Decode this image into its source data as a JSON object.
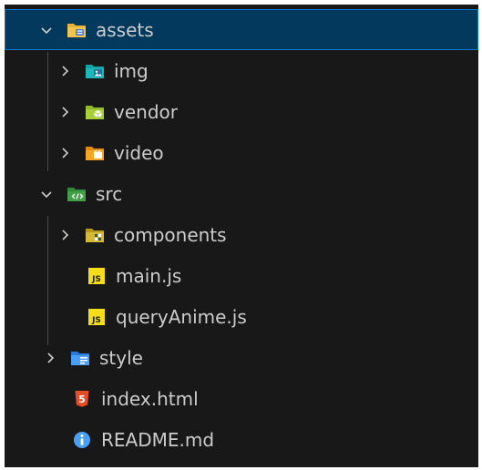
{
  "explorer": {
    "items": [
      {
        "label": "assets",
        "type": "folder",
        "state": "expanded",
        "depth": 0,
        "icon": "folder-assets-icon",
        "selected": true
      },
      {
        "label": "img",
        "type": "folder",
        "state": "collapsed",
        "depth": 1,
        "icon": "folder-images-icon"
      },
      {
        "label": "vendor",
        "type": "folder",
        "state": "collapsed",
        "depth": 1,
        "icon": "folder-vendor-icon"
      },
      {
        "label": "video",
        "type": "folder",
        "state": "collapsed",
        "depth": 1,
        "icon": "folder-video-icon"
      },
      {
        "label": "src",
        "type": "folder",
        "state": "expanded",
        "depth": 0,
        "icon": "folder-src-icon"
      },
      {
        "label": "components",
        "type": "folder",
        "state": "collapsed",
        "depth": 1,
        "icon": "folder-components-icon"
      },
      {
        "label": "main.js",
        "type": "file",
        "depth": 1,
        "icon": "javascript-file-icon"
      },
      {
        "label": "queryAnime.js",
        "type": "file",
        "depth": 1,
        "icon": "javascript-file-icon"
      },
      {
        "label": "style",
        "type": "folder",
        "state": "collapsed",
        "depth": 0,
        "icon": "folder-style-icon"
      },
      {
        "label": "index.html",
        "type": "file",
        "depth": 0,
        "icon": "html-file-icon"
      },
      {
        "label": "README.md",
        "type": "file",
        "depth": 0,
        "icon": "info-icon"
      }
    ],
    "colors": {
      "background": "#181818",
      "selection": "#04395e",
      "selection_border": "#0078d4",
      "text": "#cccccc",
      "js_badge": "#f5de19",
      "html_badge": "#e44d26",
      "info": "#4a9ff5"
    }
  }
}
